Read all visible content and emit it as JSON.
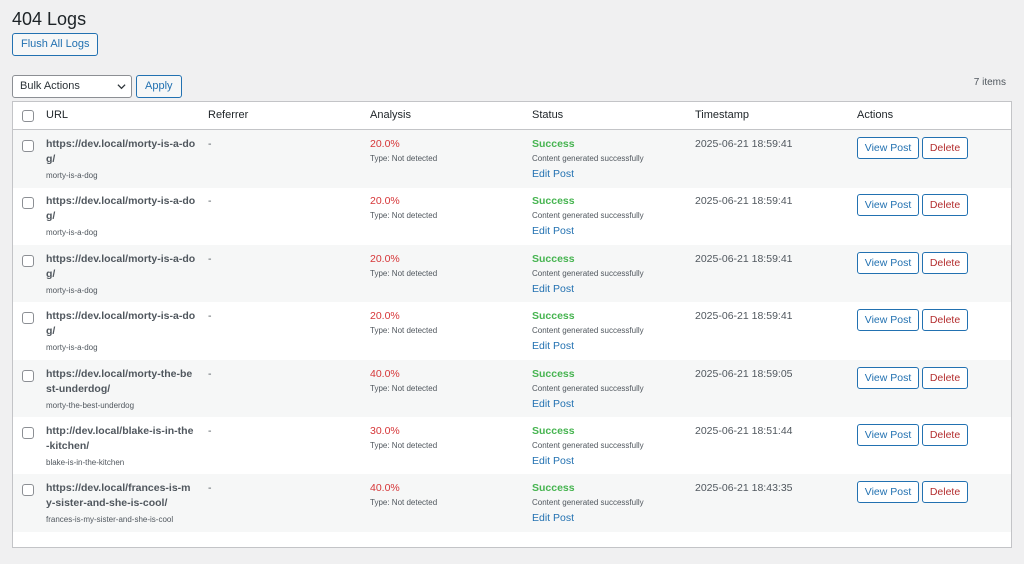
{
  "page": {
    "title": "404 Logs",
    "flush_label": "Flush All Logs"
  },
  "tablenav": {
    "bulk_selected": "Bulk Actions",
    "apply_label": "Apply",
    "items_count": "7 items"
  },
  "table": {
    "headers": {
      "url": "URL",
      "referrer": "Referrer",
      "analysis": "Analysis",
      "status": "Status",
      "timestamp": "Timestamp",
      "actions": "Actions"
    },
    "rows": [
      {
        "url": "https://dev.local/morty-is-a-dog/",
        "slug": "morty-is-a-dog",
        "referrer": "-",
        "pct": "20.0%",
        "type": "Type: Not detected",
        "status": "Success",
        "status_msg": "Content generated successfully",
        "edit": "Edit Post",
        "timestamp": "2025-06-21 18:59:41",
        "view": "View Post",
        "delete": "Delete"
      },
      {
        "url": "https://dev.local/morty-is-a-dog/",
        "slug": "morty-is-a-dog",
        "referrer": "-",
        "pct": "20.0%",
        "type": "Type: Not detected",
        "status": "Success",
        "status_msg": "Content generated successfully",
        "edit": "Edit Post",
        "timestamp": "2025-06-21 18:59:41",
        "view": "View Post",
        "delete": "Delete"
      },
      {
        "url": "https://dev.local/morty-is-a-dog/",
        "slug": "morty-is-a-dog",
        "referrer": "-",
        "pct": "20.0%",
        "type": "Type: Not detected",
        "status": "Success",
        "status_msg": "Content generated successfully",
        "edit": "Edit Post",
        "timestamp": "2025-06-21 18:59:41",
        "view": "View Post",
        "delete": "Delete"
      },
      {
        "url": "https://dev.local/morty-is-a-dog/",
        "slug": "morty-is-a-dog",
        "referrer": "-",
        "pct": "20.0%",
        "type": "Type: Not detected",
        "status": "Success",
        "status_msg": "Content generated successfully",
        "edit": "Edit Post",
        "timestamp": "2025-06-21 18:59:41",
        "view": "View Post",
        "delete": "Delete"
      },
      {
        "url": "https://dev.local/morty-the-best-underdog/",
        "slug": "morty-the-best-underdog",
        "referrer": "-",
        "pct": "40.0%",
        "type": "Type: Not detected",
        "status": "Success",
        "status_msg": "Content generated successfully",
        "edit": "Edit Post",
        "timestamp": "2025-06-21 18:59:05",
        "view": "View Post",
        "delete": "Delete"
      },
      {
        "url": "http://dev.local/blake-is-in-the-kitchen/",
        "slug": "blake-is-in-the-kitchen",
        "referrer": "-",
        "pct": "30.0%",
        "type": "Type: Not detected",
        "status": "Success",
        "status_msg": "Content generated successfully",
        "edit": "Edit Post",
        "timestamp": "2025-06-21 18:51:44",
        "view": "View Post",
        "delete": "Delete"
      },
      {
        "url": "https://dev.local/frances-is-my-sister-and-she-is-cool/",
        "slug": "frances-is-my-sister-and-she-is-cool",
        "referrer": "-",
        "pct": "40.0%",
        "type": "Type: Not detected",
        "status": "Success",
        "status_msg": "Content generated successfully",
        "edit": "Edit Post",
        "timestamp": "2025-06-21 18:43:35",
        "view": "View Post",
        "delete": "Delete"
      }
    ]
  }
}
